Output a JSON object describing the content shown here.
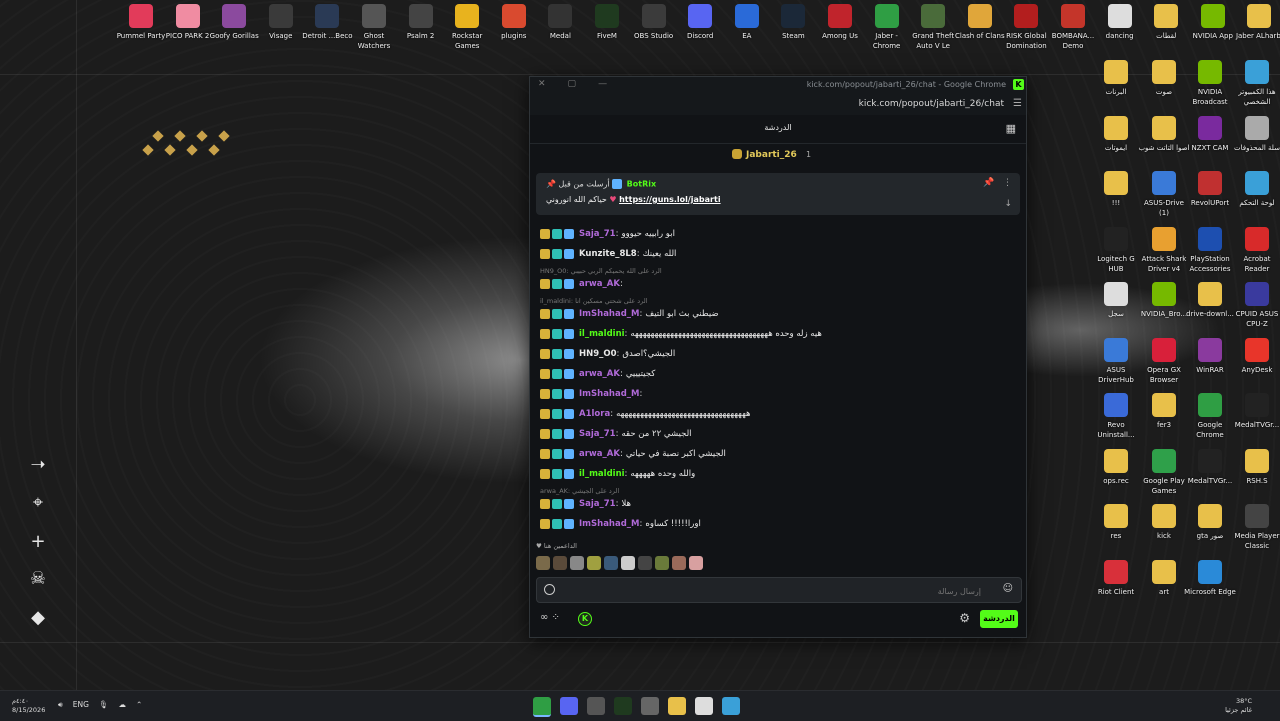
{
  "desktop": {
    "top_icons": [
      {
        "label": "Pummel Party",
        "color": "#e23b5a"
      },
      {
        "label": "PICO PARK 2",
        "color": "#f08ca2"
      },
      {
        "label": "Goofy Gorillas",
        "color": "#8b4a9e"
      },
      {
        "label": "Visage",
        "color": "#3a3a3a"
      },
      {
        "label": "Detroit ...Beco",
        "color": "#2a3a55"
      },
      {
        "label": "Ghost Watchers",
        "color": "#555"
      },
      {
        "label": "Psalm 2",
        "color": "#444"
      },
      {
        "label": "Rockstar Games",
        "color": "#e8b31e"
      },
      {
        "label": "plugins",
        "color": "#d94a2f"
      },
      {
        "label": "Medal",
        "color": "#333"
      },
      {
        "label": "FiveM",
        "color": "#1f3a1f"
      },
      {
        "label": "OBS Studio",
        "color": "#3b3b3b"
      },
      {
        "label": "Discord",
        "color": "#5865f2"
      },
      {
        "label": "EA",
        "color": "#2a6ad8"
      },
      {
        "label": "Steam",
        "color": "#1b2838"
      },
      {
        "label": "Among Us",
        "color": "#c0242c"
      },
      {
        "label": "Jaber - Chrome",
        "color": "#2f9e44"
      },
      {
        "label": "Grand Theft Auto V Le",
        "color": "#4a6b3a"
      },
      {
        "label": "Clash of Clans",
        "color": "#e0a63a"
      },
      {
        "label": "RISK Global Domination",
        "color": "#b31e1e"
      },
      {
        "label": "BOMBANA... Demo",
        "color": "#c4352a"
      },
      {
        "label": "dancing",
        "color": "#ddd"
      },
      {
        "label": "لقطات",
        "color": "#e8c04a"
      },
      {
        "label": "NVIDIA App",
        "color": "#76b900"
      },
      {
        "label": "Jaber ALharbi",
        "color": "#e8c04a"
      }
    ],
    "right_icons": [
      {
        "label": "البرنات",
        "color": "#e8c04a"
      },
      {
        "label": "صوت",
        "color": "#e8c04a"
      },
      {
        "label": "NVIDIA Broadcast",
        "color": "#76b900"
      },
      {
        "label": "هذا الكمبيوتر الشخصي",
        "color": "#3aa0d8"
      },
      {
        "label": "ايموتات",
        "color": "#e8c04a"
      },
      {
        "label": "اصوا التاتت شوب",
        "color": "#e8c04a"
      },
      {
        "label": "NZXT CAM",
        "color": "#7a2a9e"
      },
      {
        "label": "سلة المحذوفات",
        "color": "#aaa"
      },
      {
        "label": "!!!",
        "color": "#e8c04a"
      },
      {
        "label": "ASUS-Drive (1)",
        "color": "#3a7ad8"
      },
      {
        "label": "RevolUPort",
        "color": "#c03030"
      },
      {
        "label": "لوحة التحكم",
        "color": "#3aa0d8"
      },
      {
        "label": "Logitech G HUB",
        "color": "#222"
      },
      {
        "label": "Attack Shark Driver v4",
        "color": "#e8a030"
      },
      {
        "label": "PlayStation Accessories",
        "color": "#1d4fb0"
      },
      {
        "label": "Acrobat Reader",
        "color": "#d82a2a"
      },
      {
        "label": "سجل",
        "color": "#ddd"
      },
      {
        "label": "NVIDIA_Bro...",
        "color": "#76b900"
      },
      {
        "label": "drive-downl...",
        "color": "#e8c04a"
      },
      {
        "label": "CPUID ASUS CPU-Z",
        "color": "#3a3a9e"
      },
      {
        "label": "ASUS DriverHub",
        "color": "#3a7ad8"
      },
      {
        "label": "Opera GX Browser",
        "color": "#d8203a"
      },
      {
        "label": "WinRAR",
        "color": "#8a3a9e"
      },
      {
        "label": "AnyDesk",
        "color": "#e8352a"
      },
      {
        "label": "Revo Uninstall...",
        "color": "#3a6ad8"
      },
      {
        "label": "fer3",
        "color": "#e8c04a"
      },
      {
        "label": "Google Chrome",
        "color": "#2f9e44"
      },
      {
        "label": "MedalTVGr...",
        "color": "#222"
      },
      {
        "label": "ops.rec",
        "color": "#e8c04a"
      },
      {
        "label": "Google Play Games",
        "color": "#2fa04a"
      },
      {
        "label": "MedalTVGr...",
        "color": "#222"
      },
      {
        "label": "RSH.S",
        "color": "#e8c04a"
      },
      {
        "label": "res",
        "color": "#e8c04a"
      },
      {
        "label": "kick",
        "color": "#e8c04a"
      },
      {
        "label": "gta صور",
        "color": "#e8c04a"
      },
      {
        "label": "Media Player Classic",
        "color": "#444"
      },
      {
        "label": "Riot Client",
        "color": "#d8303a"
      },
      {
        "label": "art",
        "color": "#e8c04a"
      },
      {
        "label": "Microsoft Edge",
        "color": "#2a8ad8"
      }
    ]
  },
  "browser": {
    "title": "kick.com/popout/jabarti_26/chat - Google Chrome",
    "url": "kick.com/popout/jabarti_26/chat",
    "kick_badge": "K"
  },
  "chat": {
    "header_title": "الدردشة",
    "streamer_name": "Jabarti_26",
    "streamer_count": "1",
    "pinned": {
      "line1_prefix": "أرسلت من قبل",
      "line1_user": "BotRix",
      "line2_text": "حياكم الله انوروني",
      "line2_link": "https://guns.lol/jabarti"
    },
    "messages": [
      {
        "user": "Saja_71",
        "color": "#b06ad8",
        "text": "ابو رابييه حيووو"
      },
      {
        "user": "Kunzite_8L8",
        "color": "#e8e8e8",
        "text": "الله يعينك"
      },
      {
        "reply": "HN9_O0: الرد على الله يحميكم الربي حبيبي",
        "user": "arwa_AK",
        "color": "#b06ad8",
        "text": ""
      },
      {
        "reply": "il_maldini: الرد على شحتي مسكين انا",
        "user": "ImShahad_M",
        "color": "#b06ad8",
        "text": "ضيطني بث ابو التيف"
      },
      {
        "user": "il_maldini",
        "color": "#53fc18",
        "text": "هيه زله وحده هههههههههههههههههههههههههههههههههههه"
      },
      {
        "user": "HN9_O0",
        "color": "#e8e8e8",
        "text": "الجيشي؟اصدق"
      },
      {
        "user": "arwa_AK",
        "color": "#b06ad8",
        "text": "كجيتيييي"
      },
      {
        "user": "ImShahad_M",
        "color": "#b06ad8",
        "text": ""
      },
      {
        "user": "A1lora",
        "color": "#b06ad8",
        "text": "هههههههههههههههههههههههههههههههههه"
      },
      {
        "user": "Saja_71",
        "color": "#b06ad8",
        "text": "الجيشي ٢٢ من حقه"
      },
      {
        "user": "arwa_AK",
        "color": "#b06ad8",
        "text": "الجيشي اكبر نصبة في حياتي"
      },
      {
        "user": "il_maldini",
        "color": "#53fc18",
        "text": "والله وحده هههههه"
      },
      {
        "reply": "arwa_AK: الرد على الجيشي",
        "user": "Saja_71",
        "color": "#b06ad8",
        "text": "هلا"
      },
      {
        "user": "ImShahad_M",
        "color": "#b06ad8",
        "text": "اورا!!!!! كساوه"
      }
    ],
    "top_gifters_label": "الداعمين هنا",
    "input_placeholder": "إرسال رسالة",
    "send_label": "الدردشة"
  },
  "taskbar": {
    "time": "٤:٤٠م",
    "date": "8/15/2026",
    "lang": "ENG",
    "weather_temp": "38°C",
    "weather_desc": "غائم جزئيا"
  }
}
